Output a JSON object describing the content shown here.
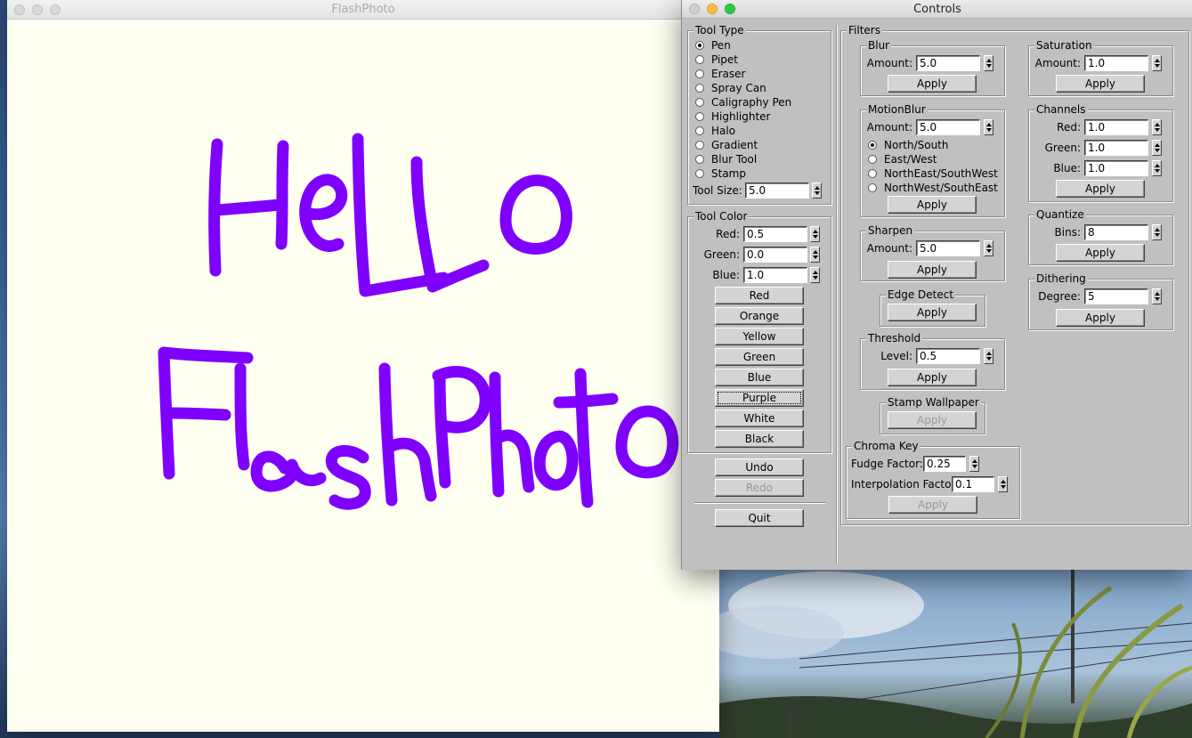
{
  "flashphoto": {
    "title": "FlashPhoto",
    "drawing_color": "#7f00ff",
    "canvas_color": "#fffff2"
  },
  "controls": {
    "title": "Controls",
    "tool_type": {
      "legend": "Tool Type",
      "tools": [
        "Pen",
        "Pipet",
        "Eraser",
        "Spray Can",
        "Caligraphy Pen",
        "Highlighter",
        "Halo",
        "Gradient",
        "Blur Tool",
        "Stamp"
      ],
      "selected_index": 0,
      "size_label": "Tool Size:",
      "size_value": "5.0"
    },
    "tool_color": {
      "legend": "Tool Color",
      "red_label": "Red:",
      "red_value": "0.5",
      "green_label": "Green:",
      "green_value": "0.0",
      "blue_label": "Blue:",
      "blue_value": "1.0",
      "presets": [
        "Red",
        "Orange",
        "Yellow",
        "Green",
        "Blue",
        "Purple",
        "White",
        "Black"
      ]
    },
    "undo": "Undo",
    "redo": "Redo",
    "quit": "Quit",
    "filters": {
      "legend": "Filters",
      "blur": {
        "legend": "Blur",
        "amount_label": "Amount:",
        "amount": "5.0",
        "apply": "Apply"
      },
      "motion_blur": {
        "legend": "MotionBlur",
        "amount_label": "Amount:",
        "amount": "5.0",
        "directions": [
          "North/South",
          "East/West",
          "NorthEast/SouthWest",
          "NorthWest/SouthEast"
        ],
        "selected_index": 0,
        "apply": "Apply"
      },
      "sharpen": {
        "legend": "Sharpen",
        "amount_label": "Amount:",
        "amount": "5.0",
        "apply": "Apply"
      },
      "edge_detect": {
        "legend": "Edge Detect",
        "apply": "Apply"
      },
      "threshold": {
        "legend": "Threshold",
        "level_label": "Level:",
        "level": "0.5",
        "apply": "Apply"
      },
      "stamp_wallpaper": {
        "legend": "Stamp Wallpaper",
        "apply": "Apply"
      },
      "chroma_key": {
        "legend": "Chroma Key",
        "fudge_label": "Fudge Factor:",
        "fudge": "0.25",
        "interp_label": "Interpolation Factor:",
        "interp": "0.1",
        "apply": "Apply"
      },
      "saturation": {
        "legend": "Saturation",
        "amount_label": "Amount:",
        "amount": "1.0",
        "apply": "Apply"
      },
      "channels": {
        "legend": "Channels",
        "red_label": "Red:",
        "red": "1.0",
        "green_label": "Green:",
        "green": "1.0",
        "blue_label": "Blue:",
        "blue": "1.0",
        "apply": "Apply"
      },
      "quantize": {
        "legend": "Quantize",
        "bins_label": "Bins:",
        "bins": "8",
        "apply": "Apply"
      },
      "dithering": {
        "legend": "Dithering",
        "degree_label": "Degree:",
        "degree": "5",
        "apply": "Apply"
      }
    }
  }
}
